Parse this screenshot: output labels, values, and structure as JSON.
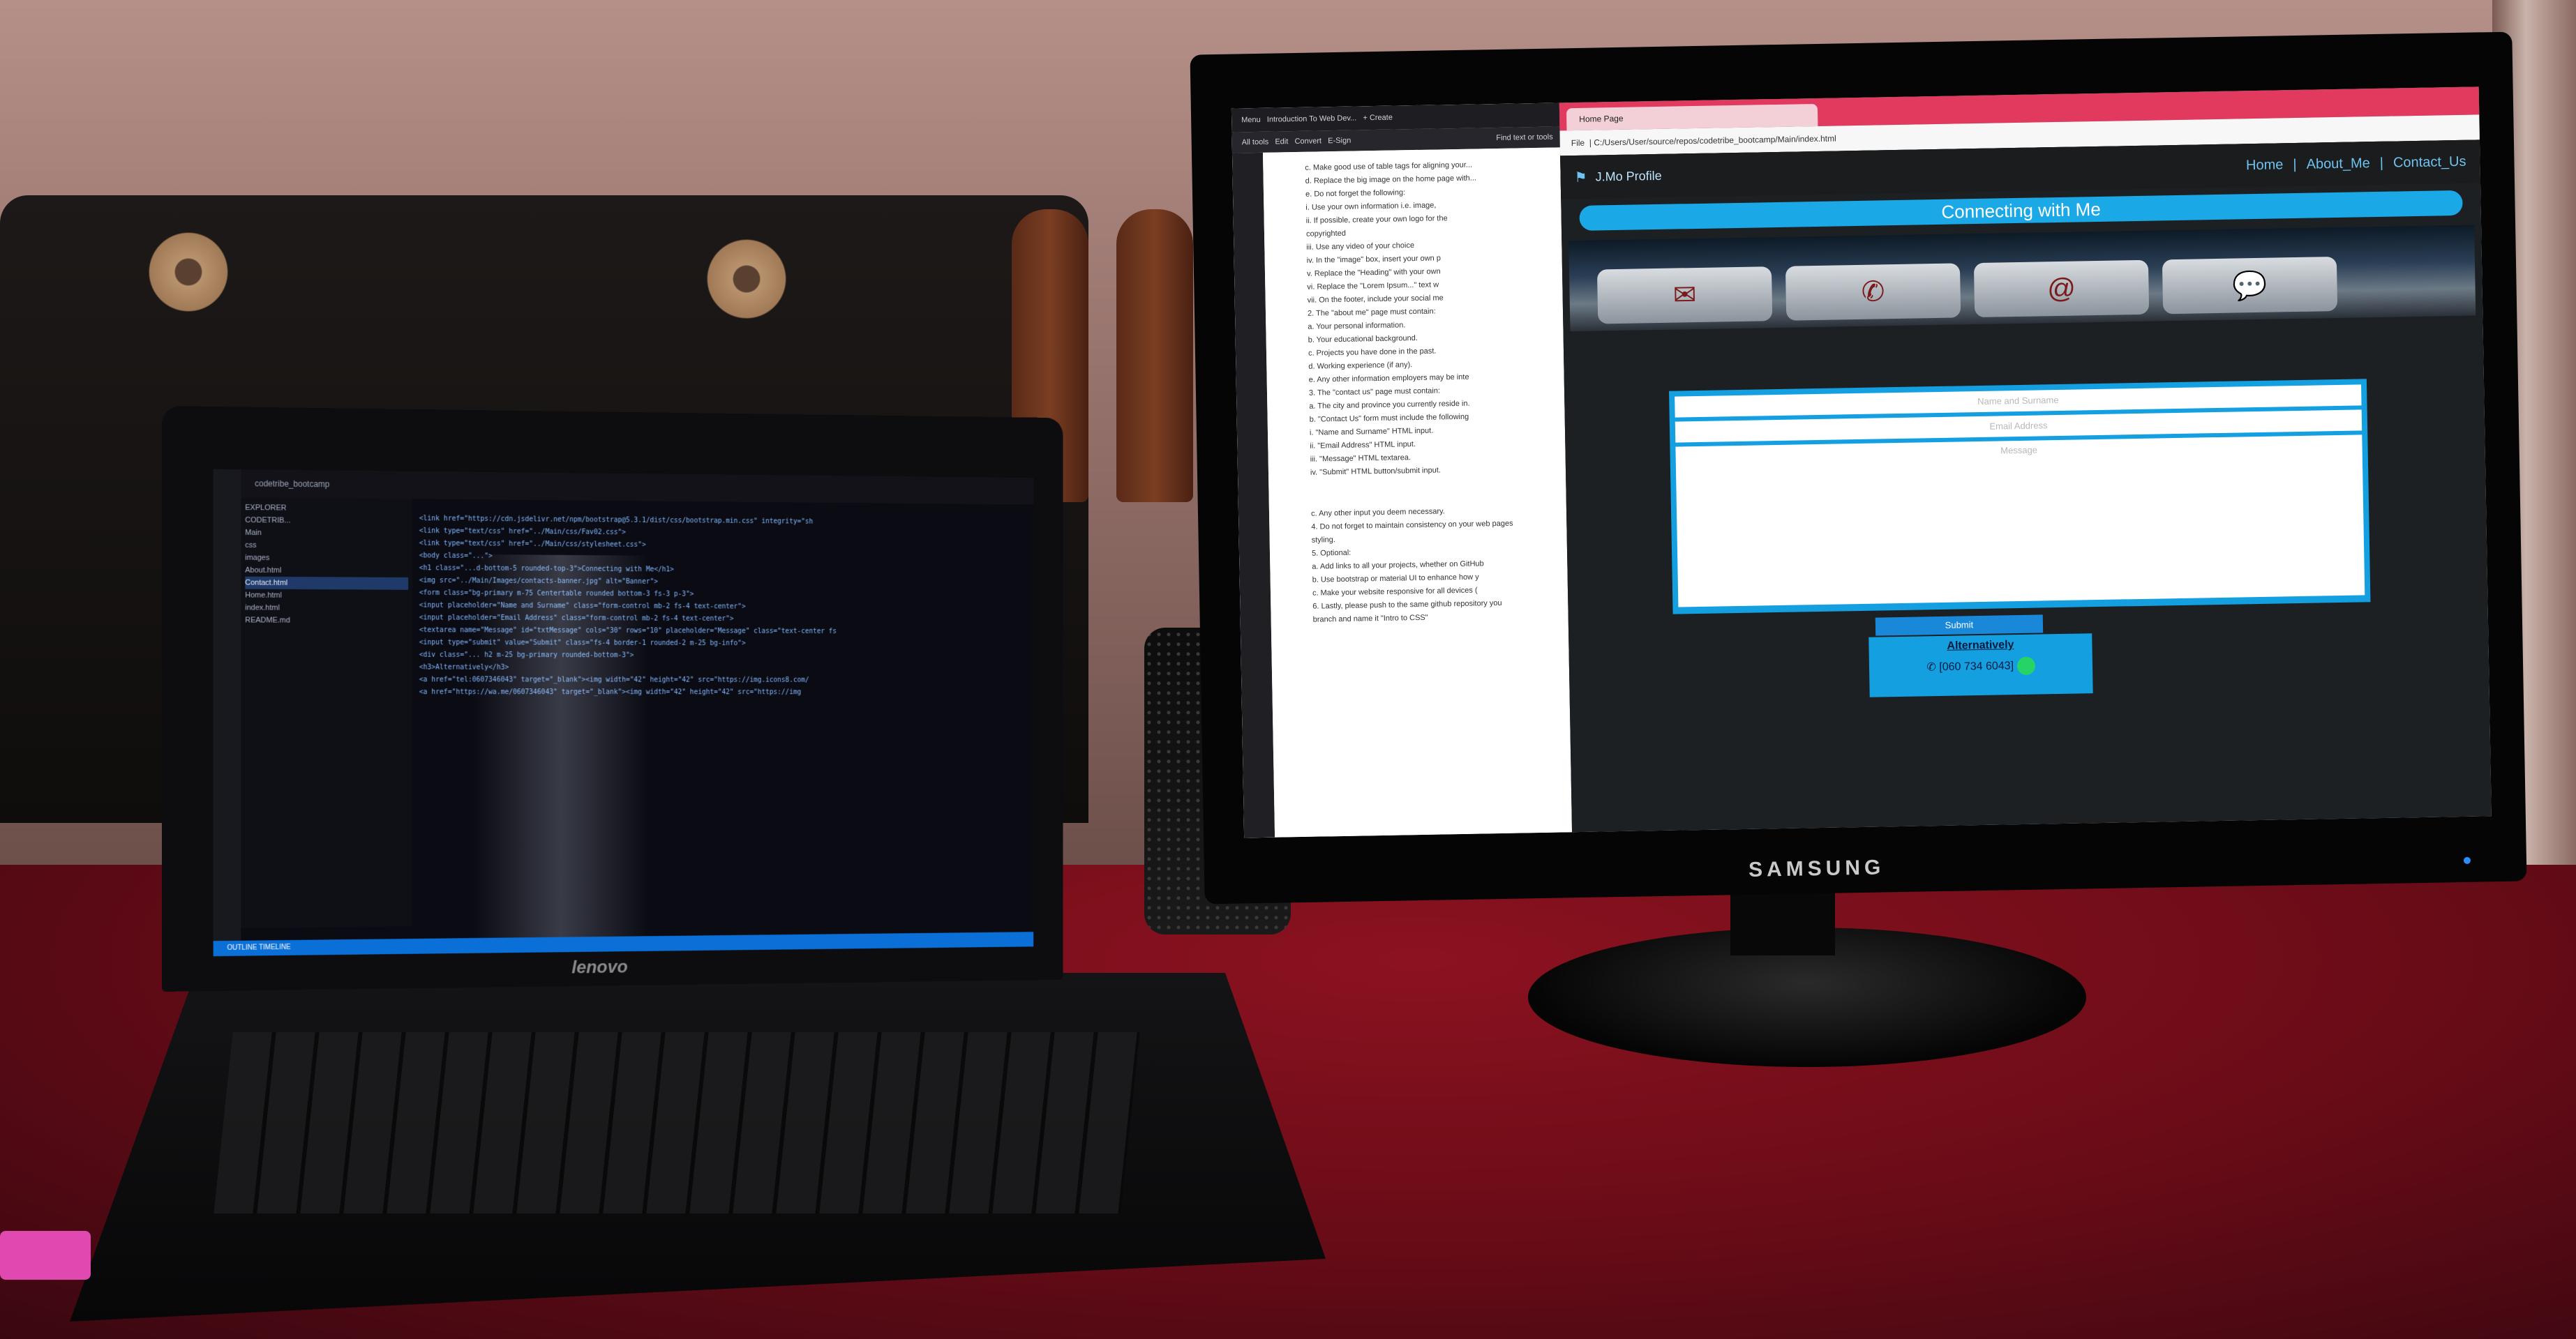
{
  "laptop": {
    "brand": "lenovo",
    "titlebar": "codetribe_bootcamp",
    "explorer_items": [
      "EXPLORER",
      "CODETRIB...",
      "Main",
      "css",
      "images",
      "About.html",
      "Contact.html",
      "Home.html",
      "index.html",
      "README.md"
    ],
    "selected_file": "Contact.html",
    "code_lines": [
      "<link href=\"https://cdn.jsdelivr.net/npm/bootstrap@5.3.1/dist/css/bootstrap.min.css\" integrity=\"sh",
      "<link type=\"text/css\" href=\"../Main/css/Fav02.css\">",
      "<link type=\"text/css\" href=\"../Main/css/stylesheet.css\">",
      "",
      "<body class=\"...\">",
      "<h1 class=\"...d-bottom-5 rounded-top-3\">Connecting with Me</h1>",
      "<img src=\"../Main/Images/contacts-banner.jpg\" alt=\"Banner\">",
      "<form class=\"bg-primary m-75 Centertable rounded bottom-3 fs-3 p-3\">",
      "<input placeholder=\"Name and Surname\" class=\"form-control mb-2 fs-4 text-center\">",
      "<input placeholder=\"Email Address\" class=\"form-control mb-2 fs-4 text-center\">",
      "<textarea name=\"Message\" id=\"txtMessage\" cols=\"30\" rows=\"10\" placeholder=\"Message\" class=\"text-center fs",
      "<input type=\"submit\" value=\"Submit\" class=\"fs-4 border-1 rounded-2 m-25 bg-info\">",
      "",
      "<div class=\"... h2 m-25 bg-primary rounded-bottom-3\">",
      "<h3>Alternatively</h3>",
      "<a href=\"tel:0607346043\" target=\"_blank\"><img width=\"42\" height=\"42\" src=\"https://img.icons8.com/",
      "<a href=\"https://wa.me/0607346043\" target=\"_blank\"><img width=\"42\" height=\"42\" src=\"https://img"
    ],
    "status": "OUTLINE  TIMELINE"
  },
  "monitor": {
    "brand": "SAMSUNG",
    "pdf": {
      "menu": "Menu",
      "tab": "Introduction To Web Dev...",
      "create": "+ Create",
      "tools": [
        "All tools",
        "Edit",
        "Convert",
        "E-Sign"
      ],
      "find": "Find text or tools",
      "lines": [
        "c. Make good use of table tags for aligning your...",
        "d. Replace the big image on the home page with...",
        "e. Do not forget the following:",
        "i. Use your own information i.e. image,",
        "ii. If possible, create your own logo for the",
        "copyrighted",
        "iii. Use any video of your choice",
        "iv. In the \"image\" box, insert your own p",
        "v. Replace the \"Heading\" with your own",
        "vi. Replace the \"Lorem Ipsum...\" text w",
        "vii. On the footer, include your social me",
        "2. The \"about me\" page must contain:",
        "a. Your personal information.",
        "b. Your educational background.",
        "c. Projects you have done in the past.",
        "d. Working experience (if any).",
        "e. Any other information employers may be inte",
        "3. The \"contact us\" page must contain:",
        "a. The city and province you currently reside in.",
        "b. \"Contact Us\" form must include the following",
        "i. \"Name and Surname\" HTML input.",
        "ii. \"Email Address\" HTML input.",
        "iii. \"Message\" HTML textarea.",
        "iv. \"Submit\" HTML button/submit input."
      ],
      "lines2": [
        "c. Any other input you deem necessary.",
        "4. Do not forget to maintain consistency on your web pages",
        "styling.",
        "5. Optional:",
        "a. Add links to all your projects, whether on GitHub",
        "b. Use bootstrap or material UI to enhance how y",
        "c. Make your website responsive for all devices (",
        "6. Lastly, please push to the same github repository you",
        "branch and name it \"Intro to CSS\""
      ]
    },
    "browser": {
      "tab_title": "Home Page",
      "url_prefix": "File",
      "url": "C:/Users/User/source/repos/codetribe_bootcamp/Main/index.html",
      "site": {
        "brand": "J.Mo Profile",
        "nav": [
          "Home",
          "|",
          "About_Me",
          "|",
          "Contact_Us"
        ],
        "banner": "Connecting with Me",
        "form": {
          "name_placeholder": "Name and Surname",
          "email_placeholder": "Email Address",
          "message_placeholder": "Message",
          "submit": "Submit"
        },
        "alt_heading": "Alternatively",
        "phone": "[060 734 6043]"
      }
    }
  },
  "colors": {
    "site_accent": "#1aa9e6",
    "tab_accent": "#e23a5e",
    "vscode_status": "#0a6fd6"
  }
}
